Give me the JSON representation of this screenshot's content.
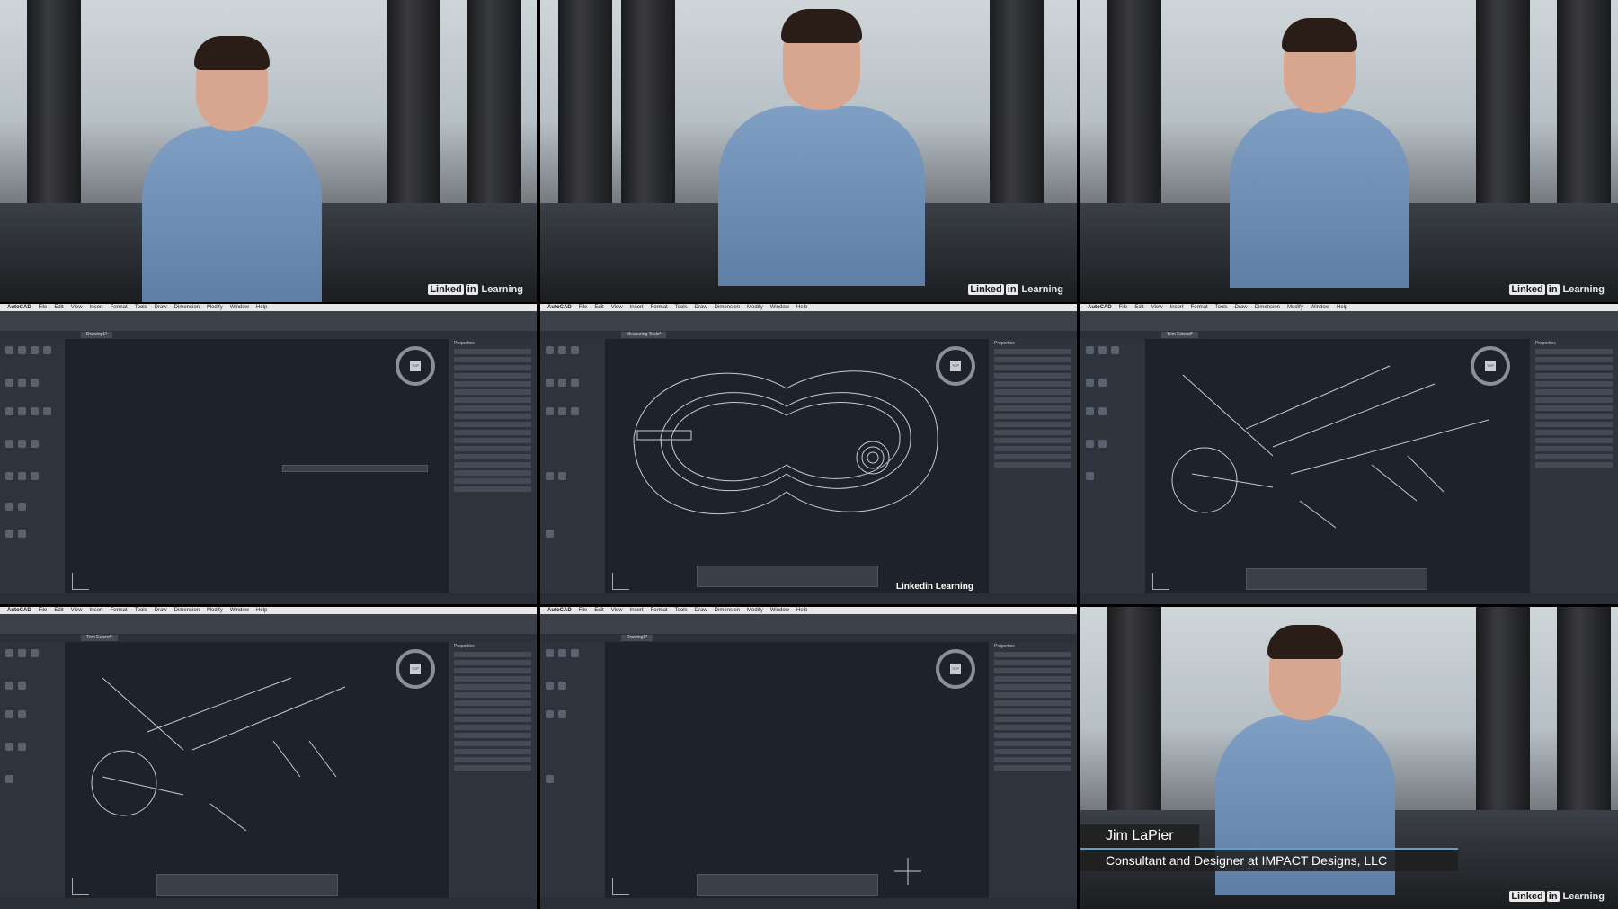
{
  "presenter": {
    "name": "Jim LaPier",
    "title": "Consultant and Designer at IMPACT Designs, LLC"
  },
  "watermark": {
    "brand": "Linked",
    "brand_box": "in",
    "suffix": "Learning"
  },
  "autocad": {
    "app_name": "AutoCAD",
    "menu_items": [
      "File",
      "Edit",
      "View",
      "Insert",
      "Format",
      "Tools",
      "Draw",
      "Dimension",
      "Modify",
      "Window",
      "Help"
    ],
    "files": [
      "Drawing1*",
      "Measuring Tools*",
      "Trim Extend*",
      "Trim Extend*",
      "Drawing1*"
    ],
    "panel_title": "Properties",
    "viewcube_top": "TOP"
  }
}
